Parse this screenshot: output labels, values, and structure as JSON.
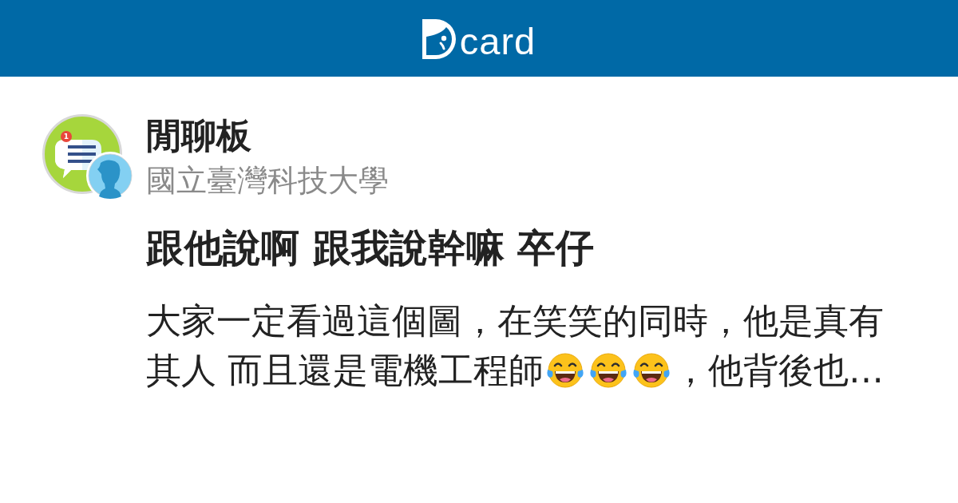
{
  "header": {
    "logo_text": "card"
  },
  "forum": {
    "badge": "1",
    "name": "閒聊板",
    "school": "國立臺灣科技大學"
  },
  "post": {
    "title": "跟他說啊 跟我說幹嘛 卒仔",
    "excerpt_lines": [
      [
        {
          "kind": "text",
          "text": "大家一定看過這個圖，在笑笑的同時，他是真有"
        }
      ],
      [
        {
          "kind": "text",
          "text": "其人 而且還是電機工程師"
        },
        {
          "kind": "emoji"
        },
        {
          "kind": "emoji"
        },
        {
          "kind": "emoji"
        },
        {
          "kind": "text",
          "text": "，他背後也…"
        }
      ]
    ]
  }
}
